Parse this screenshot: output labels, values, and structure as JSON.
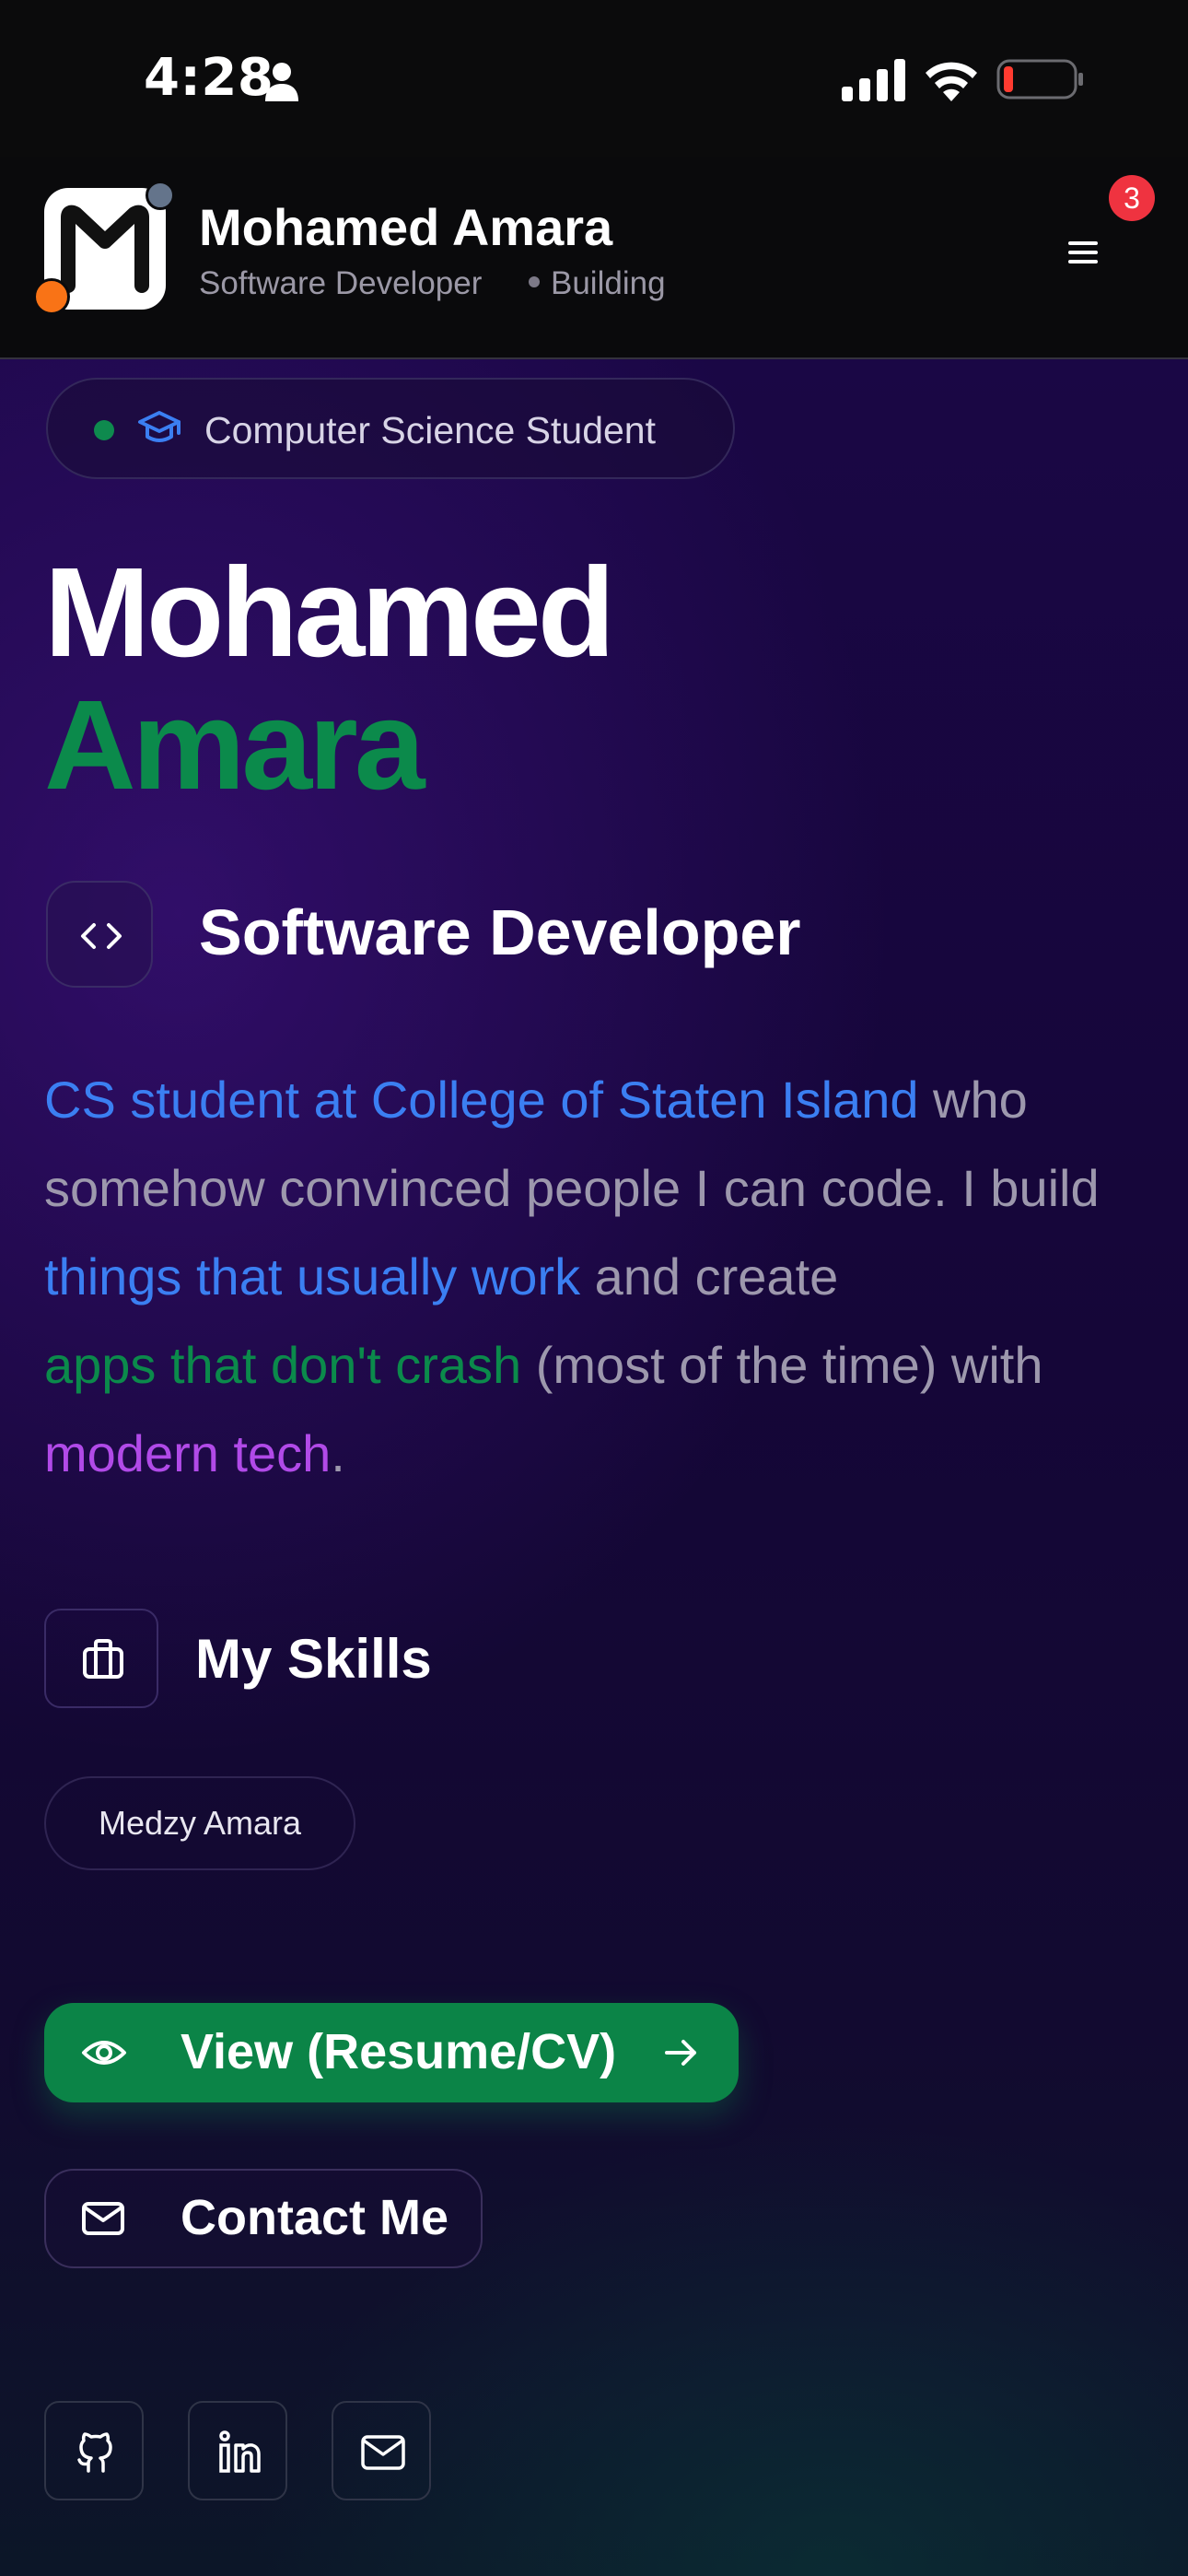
{
  "status_bar": {
    "time": "4:28",
    "icons": [
      "person-icon",
      "signal-icon",
      "wifi-icon",
      "battery-icon"
    ],
    "battery_level": 0.1,
    "battery_color": "#ff3b30"
  },
  "header": {
    "name": "Mohamed Amara",
    "role": "Software Developer",
    "status": "Building",
    "notification_count": "3",
    "menu_icon": "hamburger-menu-icon"
  },
  "hero": {
    "badge": "Computer Science Student",
    "first_name": "Mohamed",
    "last_name": "Amara",
    "title": "Software Developer",
    "bio": {
      "part1": "CS student at College of Staten Island",
      "part2": " who somehow convinced people I can code. I build ",
      "part3": "things that usually work",
      "part4": " and create ",
      "part5": "apps that don't crash",
      "part6": " (most of the time) with ",
      "part7": "modern tech",
      "part8": "."
    }
  },
  "skills": {
    "title": "My Skills",
    "items": [
      "Medzy Amara"
    ]
  },
  "actions": {
    "primary_label": "View (Resume/CV)",
    "secondary_label": "Contact Me"
  },
  "social": [
    "github-icon",
    "linkedin-icon",
    "mail-icon"
  ],
  "colors": {
    "accent_green": "#0b8447",
    "accent_blue": "#3b7ff2",
    "accent_purple": "#b14ae8",
    "badge_red": "#ef3340"
  }
}
